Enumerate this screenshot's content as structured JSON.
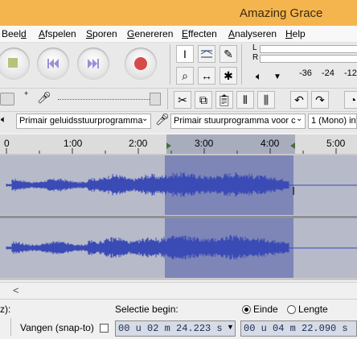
{
  "window": {
    "title": "Amazing Grace"
  },
  "menu": {
    "items": [
      {
        "pre": "Beel",
        "u": "d",
        "post": ""
      },
      {
        "pre": "",
        "u": "A",
        "post": "fspelen"
      },
      {
        "pre": "",
        "u": "S",
        "post": "poren"
      },
      {
        "pre": "",
        "u": "G",
        "post": "enereren"
      },
      {
        "pre": "",
        "u": "E",
        "post": "ffecten"
      },
      {
        "pre": "",
        "u": "A",
        "post": "nalyseren"
      },
      {
        "pre": "",
        "u": "H",
        "post": "elp"
      }
    ]
  },
  "meter": {
    "channels": [
      "L",
      "R"
    ],
    "ticks": [
      "-36",
      "-24",
      "-12"
    ]
  },
  "devices": {
    "playback_device": "Primair geluidsstuurprogramma",
    "recording_device": "Primair stuurprogramma voor c",
    "channels": "1 (Mono) inv"
  },
  "timeline": {
    "labels": [
      "0",
      "1:00",
      "2:00",
      "3:00",
      "4:00",
      "5:00"
    ],
    "selection_start": "2:24.223",
    "selection_end": "4:22.090"
  },
  "scroll": {
    "left_arrow": "<"
  },
  "selection_toolbar": {
    "project_rate_tail": "z):",
    "selection_begin_label": "Selectie begin:",
    "end_label": "Einde",
    "length_label": "Lengte",
    "snap_label": "Vangen (snap-to)",
    "begin_value": "00 u 02 m 24.223 s",
    "end_value": "00 u 04 m 22.090 s"
  },
  "colors": {
    "title_bar": "#f5b54e",
    "waveform": "#3b4bb5",
    "selection": "#7d86b7"
  }
}
